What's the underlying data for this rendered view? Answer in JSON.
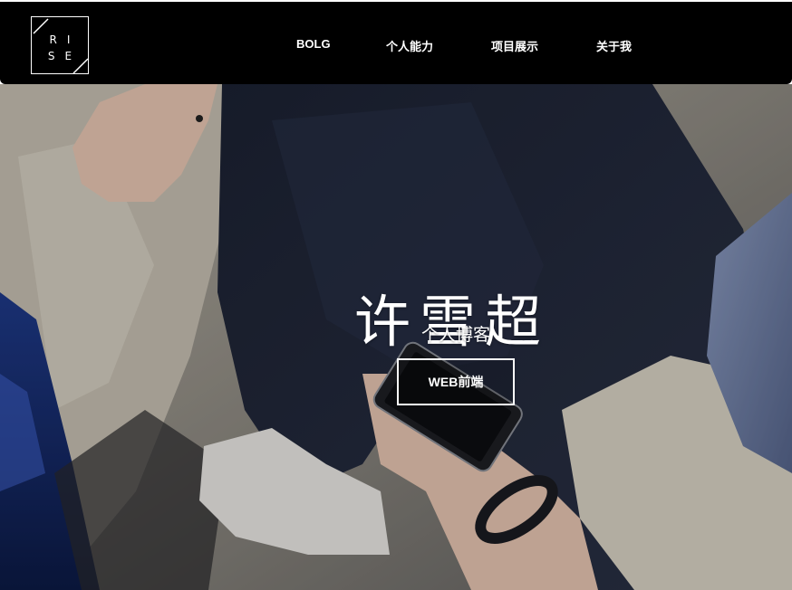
{
  "logo": {
    "letters_top": [
      "R",
      "I"
    ],
    "letters_bottom": [
      "S",
      "E"
    ]
  },
  "nav": {
    "items": [
      {
        "label": "BOLG"
      },
      {
        "label": "个人能力"
      },
      {
        "label": "项目展示"
      },
      {
        "label": "关于我"
      }
    ]
  },
  "hero": {
    "title": "许雪超",
    "subtitle": "个人博客",
    "button_label": "WEB前端"
  },
  "colors": {
    "navbar_bg": "#000000",
    "text": "#ffffff"
  }
}
